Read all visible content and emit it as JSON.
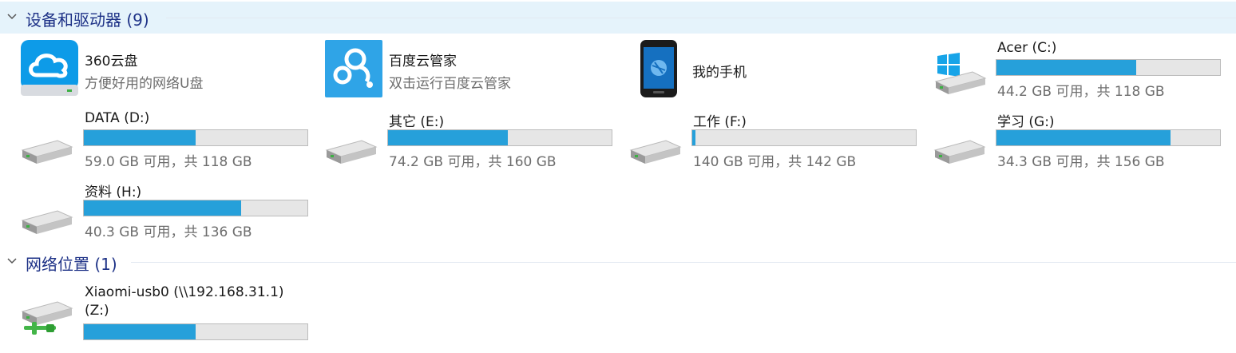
{
  "groups": {
    "devices": {
      "title": "设备和驱动器 (9)"
    },
    "network": {
      "title": "网络位置 (1)"
    }
  },
  "apps": [
    {
      "name": "360云盘",
      "desc": "方便好用的网络U盘",
      "icon": "cloud-disk-icon"
    },
    {
      "name": "百度云管家",
      "desc": "双击运行百度云管家",
      "icon": "baidu-cloud-icon"
    },
    {
      "name": "我的手机",
      "icon": "phone-icon"
    }
  ],
  "drives": [
    {
      "name": "Acer (C:)",
      "free": "44.2 GB 可用，共 118 GB",
      "used_fraction": 0.625,
      "icon": "windows-drive-icon"
    },
    {
      "name": "DATA (D:)",
      "free": "59.0 GB 可用，共 118 GB",
      "used_fraction": 0.5,
      "icon": "hard-drive-icon"
    },
    {
      "name": "其它 (E:)",
      "free": "74.2 GB 可用，共 160 GB",
      "used_fraction": 0.536,
      "icon": "hard-drive-icon"
    },
    {
      "name": "工作 (F:)",
      "free": "140 GB 可用，共 142 GB",
      "used_fraction": 0.014,
      "icon": "hard-drive-icon"
    },
    {
      "name": "学习 (G:)",
      "free": "34.3 GB 可用，共 156 GB",
      "used_fraction": 0.78,
      "icon": "hard-drive-icon"
    },
    {
      "name": "资料 (H:)",
      "free": "40.3 GB 可用，共 136 GB",
      "used_fraction": 0.704,
      "icon": "hard-drive-icon"
    }
  ],
  "network_drives": [
    {
      "name_line1": "Xiaomi-usb0 (\\\\192.168.31.1)",
      "name_line2": "(Z:)",
      "used_fraction": 0.5,
      "icon": "network-drive-icon"
    }
  ],
  "colors": {
    "bar_fill": "#26a0da",
    "bar_bg": "#e6e6e6",
    "header_text": "#1e3287",
    "header_bg": "#e5f3fb"
  }
}
